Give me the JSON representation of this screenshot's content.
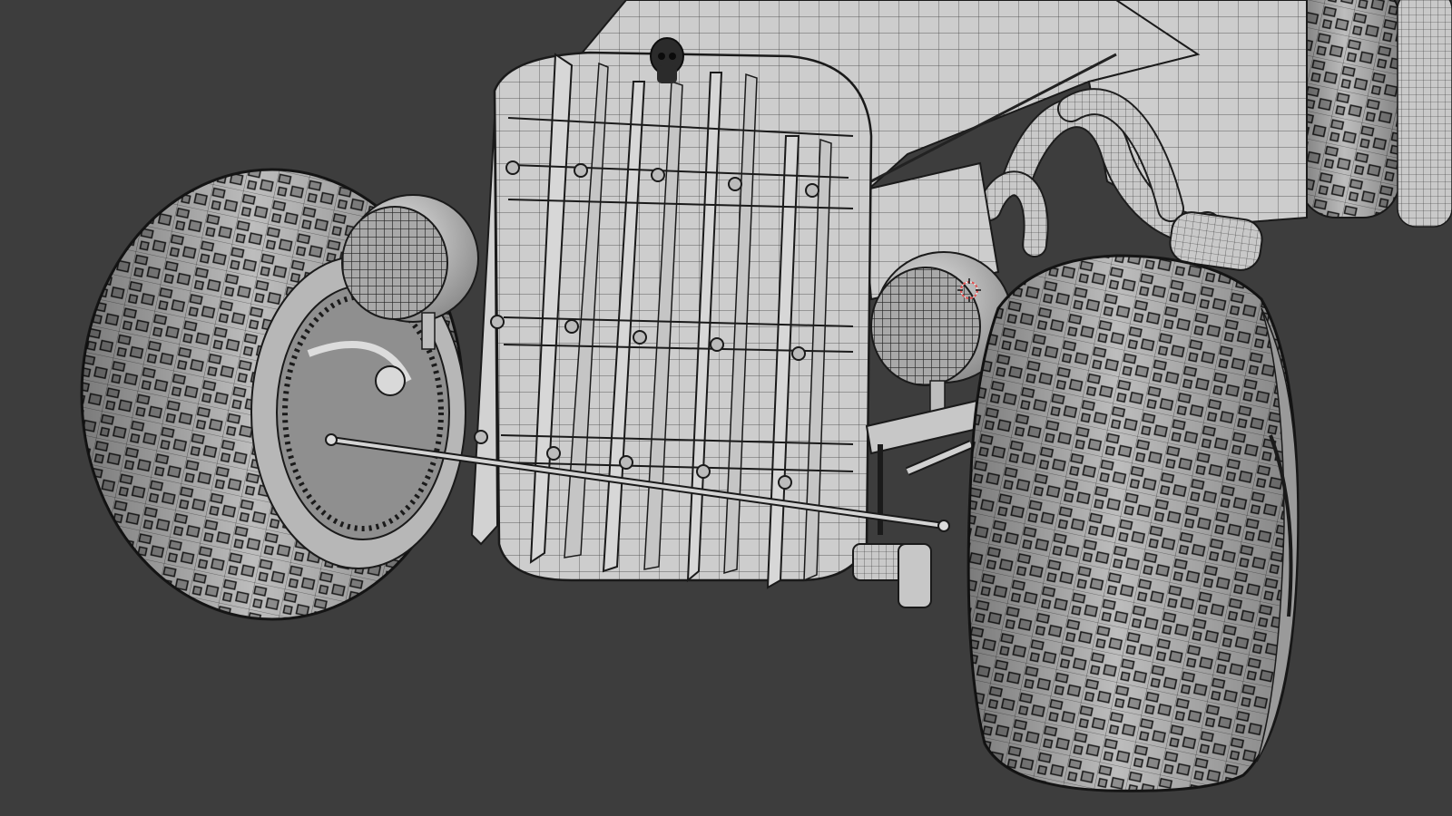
{
  "viewport": {
    "background_color": "#3d3d3d",
    "display_mode": "solid-with-wireframe-overlay",
    "scene_subject": "hot-rod-front-end-3d-model",
    "model_color": "#cfcfcf",
    "wire_color": "#1e1e1e",
    "cursor_icon": "3d-cursor-icon",
    "cursor_color": "#e05050"
  }
}
